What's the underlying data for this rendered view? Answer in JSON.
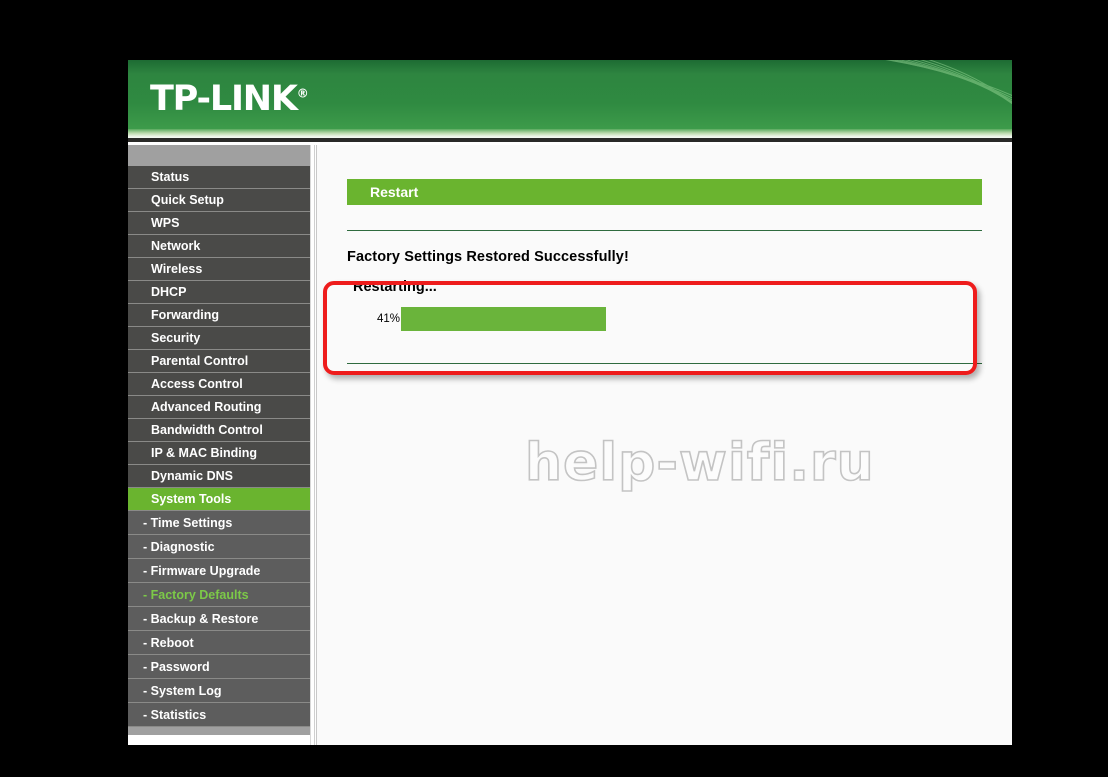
{
  "brand": {
    "logo_text": "TP-LINK",
    "registered_mark": "®"
  },
  "sidebar": {
    "items": [
      {
        "label": "Status",
        "type": "top",
        "state": "normal"
      },
      {
        "label": "Quick Setup",
        "type": "top",
        "state": "normal"
      },
      {
        "label": "WPS",
        "type": "top",
        "state": "normal"
      },
      {
        "label": "Network",
        "type": "top",
        "state": "normal"
      },
      {
        "label": "Wireless",
        "type": "top",
        "state": "normal"
      },
      {
        "label": "DHCP",
        "type": "top",
        "state": "normal"
      },
      {
        "label": "Forwarding",
        "type": "top",
        "state": "normal"
      },
      {
        "label": "Security",
        "type": "top",
        "state": "normal"
      },
      {
        "label": "Parental Control",
        "type": "top",
        "state": "normal"
      },
      {
        "label": "Access Control",
        "type": "top",
        "state": "normal"
      },
      {
        "label": "Advanced Routing",
        "type": "top",
        "state": "normal"
      },
      {
        "label": "Bandwidth Control",
        "type": "top",
        "state": "normal"
      },
      {
        "label": "IP & MAC Binding",
        "type": "top",
        "state": "normal"
      },
      {
        "label": "Dynamic DNS",
        "type": "top",
        "state": "normal"
      },
      {
        "label": "System Tools",
        "type": "top",
        "state": "active-parent"
      },
      {
        "label": "- Time Settings",
        "type": "sub",
        "state": "normal"
      },
      {
        "label": "- Diagnostic",
        "type": "sub",
        "state": "normal"
      },
      {
        "label": "- Firmware Upgrade",
        "type": "sub",
        "state": "normal"
      },
      {
        "label": "- Factory Defaults",
        "type": "sub",
        "state": "active-sub"
      },
      {
        "label": "- Backup & Restore",
        "type": "sub",
        "state": "normal"
      },
      {
        "label": "- Reboot",
        "type": "sub",
        "state": "normal"
      },
      {
        "label": "- Password",
        "type": "sub",
        "state": "normal"
      },
      {
        "label": "- System Log",
        "type": "sub",
        "state": "normal"
      },
      {
        "label": "- Statistics",
        "type": "sub",
        "state": "normal"
      }
    ]
  },
  "main": {
    "section_title": "Restart",
    "restored_message": "Factory Settings Restored Successfully!",
    "restarting_label": "Restarting...",
    "progress": {
      "percent_label": "41%",
      "percent_value": 41
    }
  },
  "watermark": {
    "text": "help-wifi.ru"
  },
  "colors": {
    "brand_green": "#6ab42f",
    "header_green": "#2f8a41",
    "progress_green": "#6ab43b",
    "sidebar_bg": "#4a4a48",
    "sidebar_sub_bg": "#5d5d5d",
    "highlight_red": "#ee1c1c",
    "rule_green": "#2f6b3f"
  }
}
